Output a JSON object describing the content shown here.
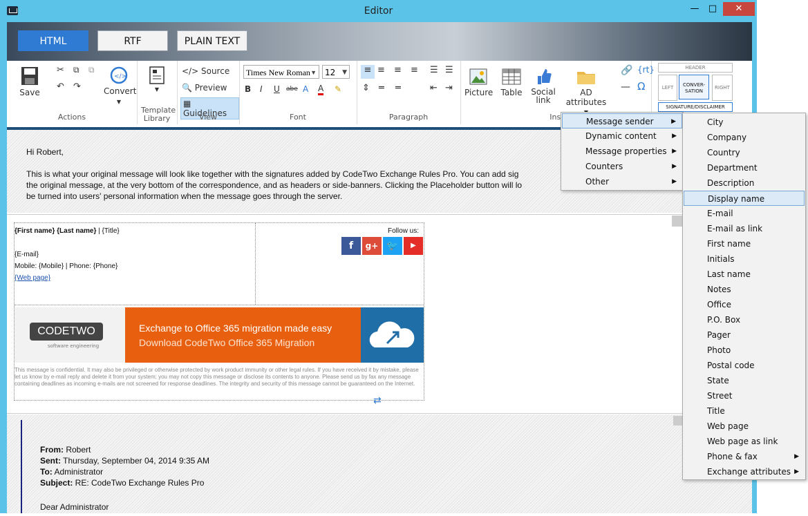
{
  "window": {
    "title": "Editor",
    "minimize": "—",
    "maximize": "□",
    "close": "✕"
  },
  "modes": {
    "html": "HTML",
    "rtf": "RTF",
    "plain": "PLAIN TEXT"
  },
  "actions": {
    "save": "Save",
    "convert": "Convert",
    "label": "Actions"
  },
  "template": {
    "label1": "Template",
    "label2": "Library"
  },
  "view": {
    "source": "Source",
    "preview": "Preview",
    "guidelines": "Guidelines",
    "label": "View"
  },
  "font": {
    "family": "Times New Roman",
    "size": "12",
    "label": "Font"
  },
  "paragraph": {
    "label": "Paragraph"
  },
  "insert": {
    "picture": "Picture",
    "table": "Table",
    "social1": "Social",
    "social2": "link",
    "ad": "AD attributes",
    "label": "Inse",
    "rt": "{rt}"
  },
  "position": {
    "header": "HEADER",
    "left": "LEFT",
    "conv1": "CONVER-",
    "conv2": "SATION",
    "right": "RIGHT",
    "sig": "SIGNATURE/DISCLAIMER"
  },
  "content": {
    "greeting": "Hi Robert,",
    "line1": "This is what your original message will look like together with the signatures added by CodeTwo Exchange Rules Pro. You can add sig",
    "line2": "the original message, at the very bottom of the correspondence, and as headers or side-banners. Clicking the Placeholder button will lo",
    "line3": "be turned into users' personal information when the message goes through the server."
  },
  "signature": {
    "name_line": "{First name} {Last name}",
    "sep": " | ",
    "title": "{Title}",
    "email": "{E-mail}",
    "phones": "Mobile: {Mobile} | Phone: {Phone}",
    "web": "{Web page}",
    "follow": "Follow us:",
    "logo_text": "CODETWO",
    "logo_sub": "software engineering",
    "banner1": "Exchange to Office 365 migration made easy",
    "banner2": "Download CodeTwo Office 365 Migration",
    "disclaimer": "This message is confidential. It may also be privileged or otherwise protected by work product immunity or other legal rules. If you have received it by mistake, please let us know by e-mail reply and delete it from your system; you may not copy this message or disclose its contents to anyone. Please send us by fax any message containing deadlines as incoming e-mails are not screened for response deadlines. The integrity and security of this message cannot be guaranteed on the Internet."
  },
  "quoted": {
    "from_l": "From:",
    "from_v": " Robert",
    "sent_l": "Sent:",
    "sent_v": " Thursday, September 04, 2014 9:35 AM",
    "to_l": "To:",
    "to_v": " Administrator",
    "subj_l": "Subject:",
    "subj_v": " RE: CodeTwo Exchange Rules Pro",
    "dear": "Dear Administrator"
  },
  "menu1": {
    "items": [
      "Message sender",
      "Dynamic content",
      "Message properties",
      "Counters",
      "Other"
    ]
  },
  "menu2": {
    "items": [
      "City",
      "Company",
      "Country",
      "Department",
      "Description",
      "Display name",
      "E-mail",
      "E-mail as link",
      "First name",
      "Initials",
      "Last name",
      "Notes",
      "Office",
      "P.O. Box",
      "Pager",
      "Photo",
      "Postal code",
      "State",
      "Street",
      "Title",
      "Web page",
      "Web page as link",
      "Phone & fax",
      "Exchange attributes"
    ]
  }
}
